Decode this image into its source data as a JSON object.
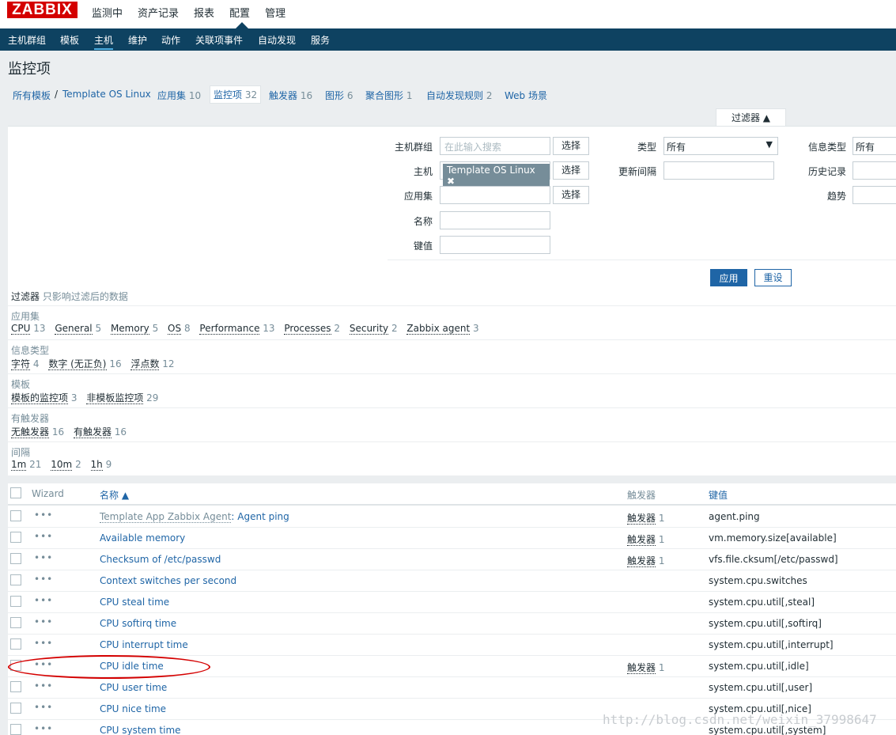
{
  "app": {
    "logo": "ZABBIX"
  },
  "top_menu": [
    "监测中",
    "资产记录",
    "报表",
    "配置",
    "管理"
  ],
  "sub_menu": [
    "主机群组",
    "模板",
    "主机",
    "维护",
    "动作",
    "关联项事件",
    "自动发现",
    "服务"
  ],
  "page_title": "监控项",
  "breadcrumb": {
    "all_templates": "所有模板",
    "sep": "/",
    "template": "Template OS Linux"
  },
  "tabs": [
    {
      "label": "应用集",
      "count": "10"
    },
    {
      "label": "监控项",
      "count": "32"
    },
    {
      "label": "触发器",
      "count": "16"
    },
    {
      "label": "图形",
      "count": "6"
    },
    {
      "label": "聚合图形",
      "count": "1"
    },
    {
      "label": "自动发现规则",
      "count": "2"
    },
    {
      "label": "Web 场景",
      "count": ""
    }
  ],
  "filter": {
    "tab_label": "过滤器 ▲",
    "host_group_label": "主机群组",
    "host_group_placeholder": "在此输入搜索",
    "host_label": "主机",
    "host_chip": "Template OS Linux",
    "host_chip_remove": "✖",
    "app_label": "应用集",
    "name_label": "名称",
    "key_label": "键值",
    "select_button": "选择",
    "type_label": "类型",
    "type_value": "所有",
    "update_interval_label": "更新间隔",
    "info_type_label": "信息类型",
    "info_type_value": "所有",
    "history_label": "历史记录",
    "trends_label": "趋势",
    "apply": "应用",
    "reset": "重设"
  },
  "subfilter": {
    "title": "过滤器",
    "note": "只影响过滤后的数据",
    "groups": [
      {
        "title": "应用集",
        "options": [
          {
            "label": "CPU",
            "count": "13"
          },
          {
            "label": "General",
            "count": "5"
          },
          {
            "label": "Memory",
            "count": "5"
          },
          {
            "label": "OS",
            "count": "8"
          },
          {
            "label": "Performance",
            "count": "13"
          },
          {
            "label": "Processes",
            "count": "2"
          },
          {
            "label": "Security",
            "count": "2"
          },
          {
            "label": "Zabbix agent",
            "count": "3"
          }
        ]
      },
      {
        "title": "信息类型",
        "options": [
          {
            "label": "字符",
            "count": "4"
          },
          {
            "label": "数字 (无正负)",
            "count": "16"
          },
          {
            "label": "浮点数",
            "count": "12"
          }
        ]
      },
      {
        "title": "模板",
        "options": [
          {
            "label": "模板的监控项",
            "count": "3"
          },
          {
            "label": "非模板监控项",
            "count": "29"
          }
        ]
      },
      {
        "title": "有触发器",
        "options": [
          {
            "label": "无触发器",
            "count": "16"
          },
          {
            "label": "有触发器",
            "count": "16"
          }
        ]
      },
      {
        "title": "间隔",
        "options": [
          {
            "label": "1m",
            "count": "21"
          },
          {
            "label": "10m",
            "count": "2"
          },
          {
            "label": "1h",
            "count": "9"
          }
        ]
      }
    ]
  },
  "table": {
    "headers": {
      "wizard": "Wizard",
      "name": "名称 ▲",
      "triggers": "触发器",
      "key": "键值"
    },
    "dots": "•••",
    "rows": [
      {
        "template": "Template App Zabbix Agent",
        "sep": ": ",
        "name": "Agent ping",
        "trigger": "触发器",
        "trigger_count": "1",
        "key": "agent.ping"
      },
      {
        "template": "",
        "sep": "",
        "name": "Available memory",
        "trigger": "触发器",
        "trigger_count": "1",
        "key": "vm.memory.size[available]"
      },
      {
        "template": "",
        "sep": "",
        "name": "Checksum of /etc/passwd",
        "trigger": "触发器",
        "trigger_count": "1",
        "key": "vfs.file.cksum[/etc/passwd]"
      },
      {
        "template": "",
        "sep": "",
        "name": "Context switches per second",
        "trigger": "",
        "trigger_count": "",
        "key": "system.cpu.switches"
      },
      {
        "template": "",
        "sep": "",
        "name": "CPU steal time",
        "trigger": "",
        "trigger_count": "",
        "key": "system.cpu.util[,steal]"
      },
      {
        "template": "",
        "sep": "",
        "name": "CPU softirq time",
        "trigger": "",
        "trigger_count": "",
        "key": "system.cpu.util[,softirq]"
      },
      {
        "template": "",
        "sep": "",
        "name": "CPU interrupt time",
        "trigger": "",
        "trigger_count": "",
        "key": "system.cpu.util[,interrupt]"
      },
      {
        "template": "",
        "sep": "",
        "name": "CPU idle time",
        "trigger": "触发器",
        "trigger_count": "1",
        "key": "system.cpu.util[,idle]"
      },
      {
        "template": "",
        "sep": "",
        "name": "CPU user time",
        "trigger": "",
        "trigger_count": "",
        "key": "system.cpu.util[,user]"
      },
      {
        "template": "",
        "sep": "",
        "name": "CPU nice time",
        "trigger": "",
        "trigger_count": "",
        "key": "system.cpu.util[,nice]"
      },
      {
        "template": "",
        "sep": "",
        "name": "CPU system time",
        "trigger": "",
        "trigger_count": "",
        "key": "system.cpu.util[,system]"
      }
    ]
  },
  "watermark": "http://blog.csdn.net/weixin_37998647",
  "colors": {
    "brand": "#d40000",
    "nav": "#0e4261",
    "link": "#1f65a6",
    "muted": "#768d99"
  }
}
